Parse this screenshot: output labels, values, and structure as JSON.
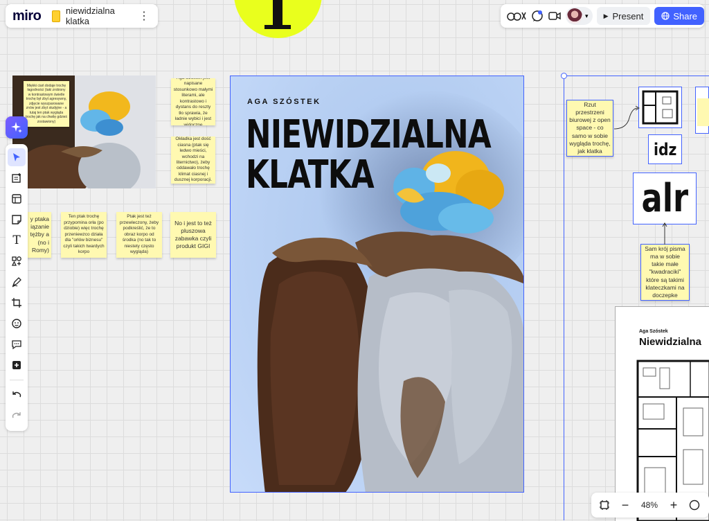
{
  "app": {
    "logo": "miro",
    "board_title": "niewidzialna klatka",
    "menu_glyph": "⋮"
  },
  "header": {
    "icons": [
      "reactions-icon",
      "chat-icon",
      "video-icon"
    ],
    "present_label": "Present",
    "share_label": "Share",
    "colors": {
      "share_bg": "#4262ff"
    }
  },
  "toolbar": {
    "tools": [
      "select-tool",
      "templates-tool",
      "frame-layout-tool",
      "sticky-note-tool",
      "text-tool",
      "shapes-tool",
      "pen-tool",
      "crop-frame-tool",
      "sticker-tool",
      "comment-tool",
      "more-tools"
    ],
    "undo": "undo-icon",
    "redo": "redo-icon"
  },
  "poster": {
    "author": "AGA SZÓSTEK",
    "title": "NIEWIDZIALNA\nKLATKA"
  },
  "stickies": {
    "img_note": "Miękki ciań dodaje trochę łagodności (taki zrobiony w kontrastowym świetle trochę był zbyt agresywny, zdjęcie wyszparowane znów jest zbyt studyjne - a tutaj ten ptak wygląda trochę jak na chwilę gdzieś zostawiony)",
    "s1": "Aga Szóstek jest napisane stosunkowo małymi literami, ale kontrastowo i dystans do reszty tło sprawia, że ładnie wybici i jest widoczne",
    "s2": "Okładka jest dość ciasna (ptak się ledwo mieści, wchodzi na liternictwo), żeby oddawało trochę klimat ciasnej i dusznej korporacji.",
    "s3": "y ptaka iązanie tężby a (no i Romy)",
    "s4": "Ten ptak trochę przypomina orła (po dziobie) więc trochę przeniewzco działa dla \"orłów biznesu\" czyli takich twardych korpo",
    "s5": "Ptak jest też przewleczony, żeby podkreślić, że to obraz korpo od środka (no tak to niestety często wygląda)",
    "s6": "No i jest to też pluszowa zabawka czyli produkt GIGI",
    "s7": "Rzut przestrzeni biurowej z open space - co samo w sobie wygląda trochę, jak klatka",
    "s8": "Sam krój pisma ma w sobie takie małe \"kwadraciki\" które są takimi klateczkami na doczepke"
  },
  "right_group": {
    "crop1": "idz",
    "crop2": "alr",
    "doc_author": "Aga Szóstek",
    "doc_title": "Niewidzialna"
  },
  "zoom": {
    "level": "48%",
    "minus": "−",
    "plus": "+"
  }
}
